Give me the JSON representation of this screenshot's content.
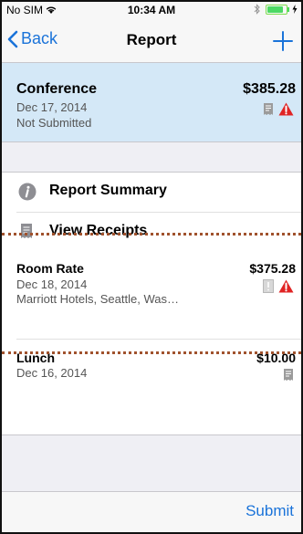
{
  "status_bar": {
    "carrier": "No SIM",
    "time": "10:34 AM"
  },
  "nav": {
    "back_label": "Back",
    "title": "Report"
  },
  "report": {
    "name": "Conference",
    "date": "Dec 17, 2014",
    "status": "Not Submitted",
    "amount": "$385.28"
  },
  "summary": {
    "items": [
      {
        "label": "Report Summary",
        "icon": "info-icon"
      },
      {
        "label": "View Receipts",
        "icon": "receipt-icon"
      }
    ]
  },
  "expenses": [
    {
      "name": "Room Rate",
      "date": "Dec 18, 2014",
      "vendor": "Marriott Hotels, Seattle, Was…",
      "amount": "$375.28",
      "icons": [
        "missing-receipt-icon",
        "warning-icon"
      ]
    },
    {
      "name": "Lunch",
      "date": "Dec 16, 2014",
      "amount": "$10.00",
      "icons": [
        "receipt-icon"
      ]
    }
  ],
  "toolbar": {
    "submit_label": "Submit"
  },
  "colors": {
    "accent": "#1a73d9",
    "header_bg": "#d4e8f7",
    "warning": "#e02424",
    "group_bg": "#efeff4",
    "dotted_line": "#a0522d"
  }
}
